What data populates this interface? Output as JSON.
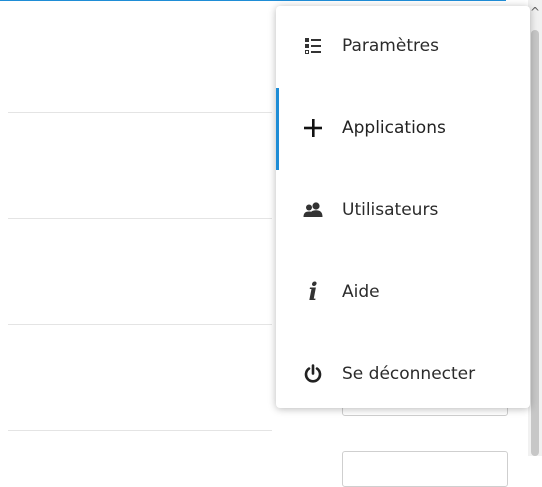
{
  "menu": {
    "items": [
      {
        "label": "Paramètres",
        "icon": "settings-list-icon",
        "active": false
      },
      {
        "label": "Applications",
        "icon": "plus-icon",
        "active": true
      },
      {
        "label": "Utilisateurs",
        "icon": "users-icon",
        "active": false
      },
      {
        "label": "Aide",
        "icon": "info-icon",
        "active": false
      },
      {
        "label": "Se déconnecter",
        "icon": "power-icon",
        "active": false
      }
    ]
  },
  "colors": {
    "accent": "#1f8dd6",
    "menu_text": "#2b2b2b",
    "icon": "#333333"
  }
}
